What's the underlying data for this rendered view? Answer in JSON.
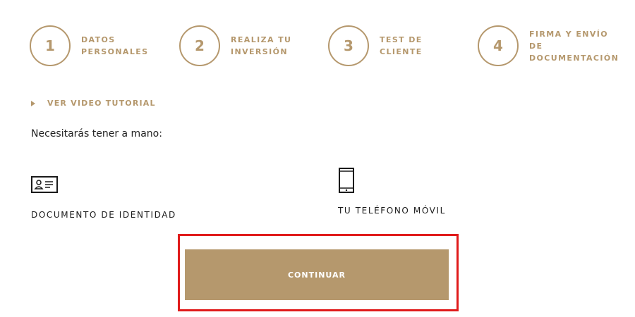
{
  "steps": [
    {
      "number": "1",
      "line1": "DATOS",
      "line2": "PERSONALES",
      "line3": ""
    },
    {
      "number": "2",
      "line1": "REALIZA TU",
      "line2": "INVERSIÓN",
      "line3": ""
    },
    {
      "number": "3",
      "line1": "TEST DE",
      "line2": "CLIENTE",
      "line3": ""
    },
    {
      "number": "4",
      "line1": "FIRMA Y ENVÍO",
      "line2": "DE",
      "line3": "DOCUMENTACIÓN"
    }
  ],
  "video_link": {
    "label": "VER VIDEO TUTORIAL",
    "icon": "play-icon"
  },
  "intro_text": "Necesitarás tener a mano:",
  "requirements": [
    {
      "icon": "id-card-icon",
      "label": "DOCUMENTO DE IDENTIDAD"
    },
    {
      "icon": "mobile-phone-icon",
      "label": "TU TELÉFONO MÓVIL"
    }
  ],
  "continue_button": {
    "label": "CONTINUAR"
  },
  "colors": {
    "accent": "#b5986d",
    "highlight": "#e01b1b",
    "text": "#1a1a1a"
  }
}
